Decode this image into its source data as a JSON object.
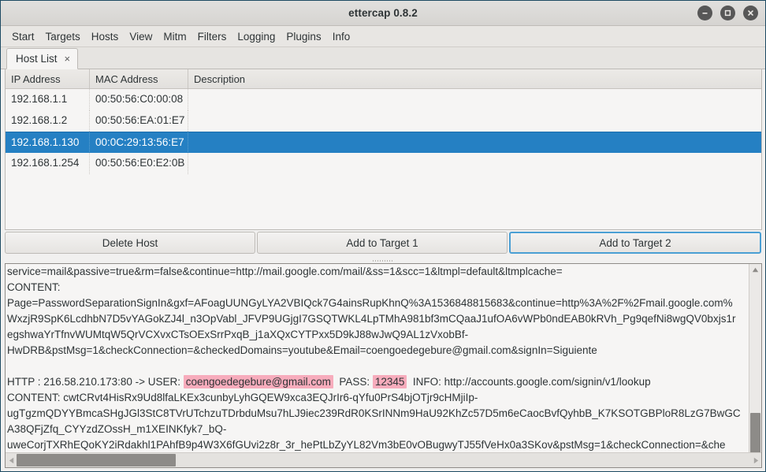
{
  "window": {
    "title": "ettercap 0.8.2",
    "controls": [
      {
        "name": "minimize-button",
        "glyph": "minimize"
      },
      {
        "name": "maximize-button",
        "glyph": "maximize"
      },
      {
        "name": "close-button",
        "glyph": "close"
      }
    ]
  },
  "menubar": {
    "items": [
      "Start",
      "Targets",
      "Hosts",
      "View",
      "Mitm",
      "Filters",
      "Logging",
      "Plugins",
      "Info"
    ]
  },
  "tabs": [
    {
      "label": "Host List",
      "close": "×",
      "active": true
    }
  ],
  "host_list": {
    "columns": [
      "IP Address",
      "MAC Address",
      "Description"
    ],
    "rows": [
      {
        "ip": "192.168.1.1",
        "mac": "00:50:56:C0:00:08",
        "desc": "",
        "selected": false
      },
      {
        "ip": "192.168.1.2",
        "mac": "00:50:56:EA:01:E7",
        "desc": "",
        "selected": false
      },
      {
        "ip": "192.168.1.130",
        "mac": "00:0C:29:13:56:E7",
        "desc": "",
        "selected": true
      },
      {
        "ip": "192.168.1.254",
        "mac": "00:50:56:E0:E2:0B",
        "desc": "",
        "selected": false
      }
    ]
  },
  "buttons": [
    {
      "label": "Delete Host",
      "focused": false
    },
    {
      "label": "Add to Target 1",
      "focused": false
    },
    {
      "label": "Add to Target 2",
      "focused": true
    }
  ],
  "log": {
    "lines": [
      {
        "segments": [
          {
            "text": "service=mail&passive=true&rm=false&continue=http://mail.google.com/mail/&ss=1&scc=1&ltmpl=default&ltmplcache=",
            "hl": false
          }
        ]
      },
      {
        "segments": [
          {
            "text": "CONTENT:",
            "hl": false
          }
        ]
      },
      {
        "segments": [
          {
            "text": "Page=PasswordSeparationSignIn&gxf=AFoagUUNGyLYA2VBIQck7G4ainsRupKhnQ%3A1536848815683&continue=http%3A%2F%2Fmail.google.com%",
            "hl": false
          }
        ]
      },
      {
        "segments": [
          {
            "text": "WxzjR9SpK6LcdhbN7D5vYAGokZJ4l_n3OpVabl_JFVP9UGjgI7GSQTWKL4LpTMhA981bf3mCQaaJ1ufOA6vWPb0ndEAB0kRVh_Pg9qefNi8wgQV0bxjs1r",
            "hl": false
          }
        ]
      },
      {
        "segments": [
          {
            "text": "egshwaYrTfnvWUMtqW5QrVCXvxCTsOExSrrPxqB_j1aXQxCYTPxx5D9kJ88wJwQ9AL1zVxobBf-",
            "hl": false
          }
        ]
      },
      {
        "segments": [
          {
            "text": "HwDRB&pstMsg=1&checkConnection=&checkedDomains=youtube&Email=coengoedegebure@gmail.com&signIn=Siguiente",
            "hl": false
          }
        ]
      },
      {
        "segments": [
          {
            "text": "",
            "hl": false
          }
        ]
      },
      {
        "segments": [
          {
            "text": "HTTP : 216.58.210.173:80 -> USER: ",
            "hl": false
          },
          {
            "text": "coengoedegebure@gmail.com",
            "hl": true
          },
          {
            "text": "  PASS: ",
            "hl": false
          },
          {
            "text": "12345",
            "hl": true
          },
          {
            "text": "  INFO: http://accounts.google.com/signin/v1/lookup",
            "hl": false
          }
        ]
      },
      {
        "segments": [
          {
            "text": "CONTENT: cwtCRvt4HisRx9Ud8lfaLKEx3cunbyLyhGQEW9xca3EQJrIr6-qYfu0PrS4bjOTjr9cHMjiIp-",
            "hl": false
          }
        ]
      },
      {
        "segments": [
          {
            "text": "ugTgzmQDYYBmcaSHgJGl3StC8TVrUTchzuTDrbduMsu7hLJ9iec239RdR0KSrINNm9HaU92KhZc57D5m6eCaocBvfQyhbB_K7KSOTGBPloR8LzG7BwGC",
            "hl": false
          }
        ]
      },
      {
        "segments": [
          {
            "text": "A38QFjZfq_CYYzdZOssH_m1XEINKfyk7_bQ-",
            "hl": false
          }
        ]
      },
      {
        "segments": [
          {
            "text": "uweCorjTXRhEQoKY2iRdakhl1PAhfB9p4W3X6fGUvi2z8r_3r_hePtLbZyYL82Vm3bE0vOBugwyTJ55fVeHx0a3SKov&pstMsg=1&checkConnection=&che",
            "hl": false
          }
        ]
      }
    ]
  },
  "colors": {
    "selection": "#2580c3",
    "highlight": "#f7acbc",
    "focus_border": "#4a9fd4",
    "scrollbar_thumb": "#8d8b88"
  }
}
